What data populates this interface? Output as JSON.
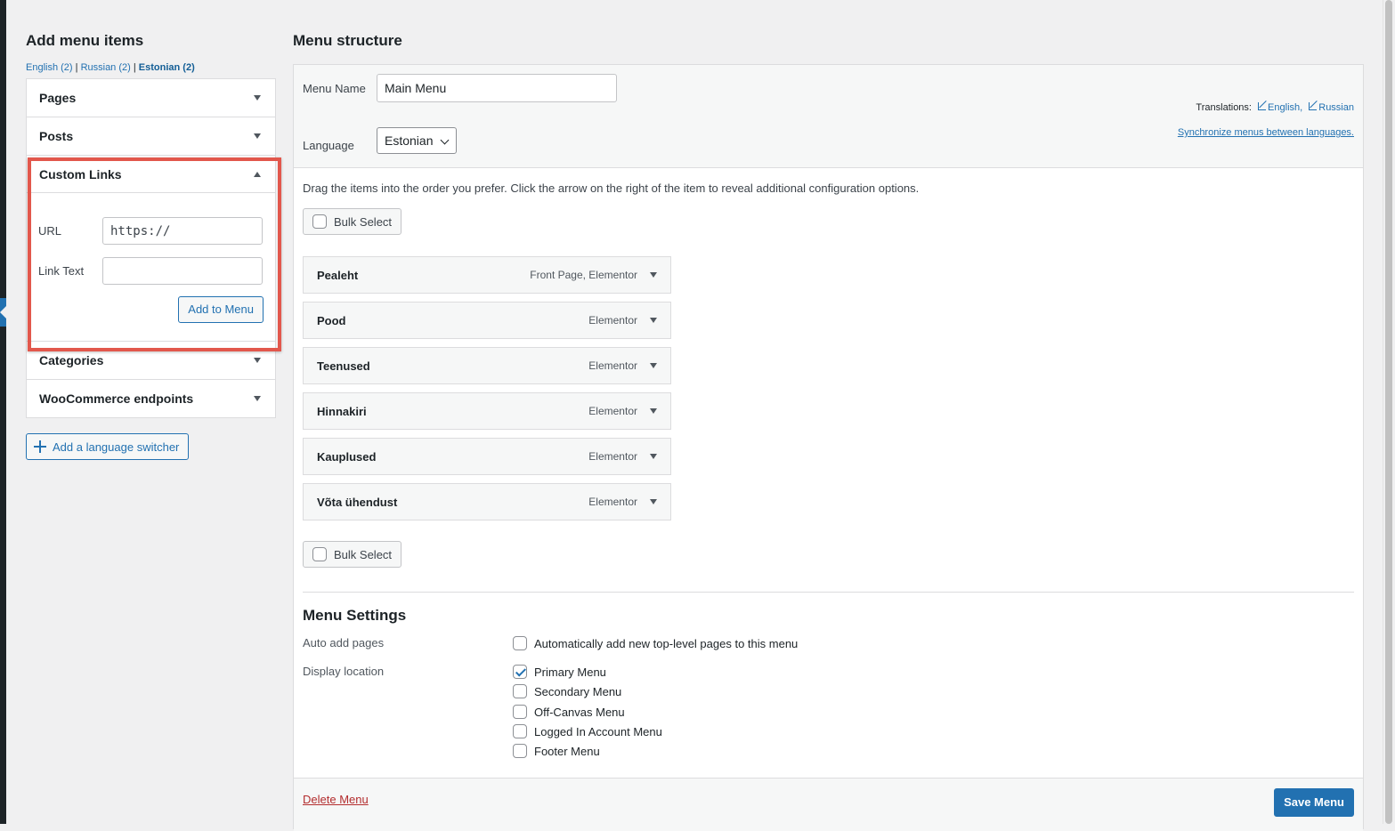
{
  "left": {
    "title": "Add menu items",
    "lang_tabs": [
      {
        "label": "English (2)"
      },
      {
        "label": "Russian (2)"
      },
      {
        "label": "Estonian (2)"
      }
    ],
    "lang_sep": "|",
    "accordion": {
      "pages": "Pages",
      "posts": "Posts",
      "custom_links": "Custom Links",
      "categories": "Categories",
      "woo": "WooCommerce endpoints"
    },
    "custom_links": {
      "url_label": "URL",
      "url_value": "https://",
      "link_text_label": "Link Text",
      "link_text_value": "",
      "add_button": "Add to Menu"
    },
    "language_switcher_button": "Add a language switcher"
  },
  "main": {
    "title": "Menu structure",
    "menu_name_label": "Menu Name",
    "menu_name_value": "Main Menu",
    "language_label": "Language",
    "language_value": "Estonian",
    "translations_label": "Translations:",
    "translations": [
      {
        "label": "English,"
      },
      {
        "label": "Russian"
      }
    ],
    "sync_link": "Synchronize menus between languages.",
    "instructions": "Drag the items into the order you prefer. Click the arrow on the right of the item to reveal additional configuration options.",
    "bulk_select": "Bulk Select",
    "items": [
      {
        "title": "Pealeht",
        "type": "Front Page, Elementor"
      },
      {
        "title": "Pood",
        "type": "Elementor"
      },
      {
        "title": "Teenused",
        "type": "Elementor"
      },
      {
        "title": "Hinnakiri",
        "type": "Elementor"
      },
      {
        "title": "Kauplused",
        "type": "Elementor"
      },
      {
        "title": "Võta ühendust",
        "type": "Elementor"
      }
    ],
    "settings": {
      "title": "Menu Settings",
      "auto_add_label": "Auto add pages",
      "auto_add_option": "Automatically add new top-level pages to this menu",
      "auto_add_checked": false,
      "display_location_label": "Display location",
      "locations": [
        {
          "label": "Primary Menu",
          "checked": true
        },
        {
          "label": "Secondary Menu",
          "checked": false
        },
        {
          "label": "Off-Canvas Menu",
          "checked": false
        },
        {
          "label": "Logged In Account Menu",
          "checked": false
        },
        {
          "label": "Footer Menu",
          "checked": false
        }
      ]
    },
    "delete_link": "Delete Menu",
    "save_button": "Save Menu"
  },
  "colors": {
    "accent": "#2271b1",
    "highlight": "#e2574c",
    "danger": "#b32d2e"
  }
}
